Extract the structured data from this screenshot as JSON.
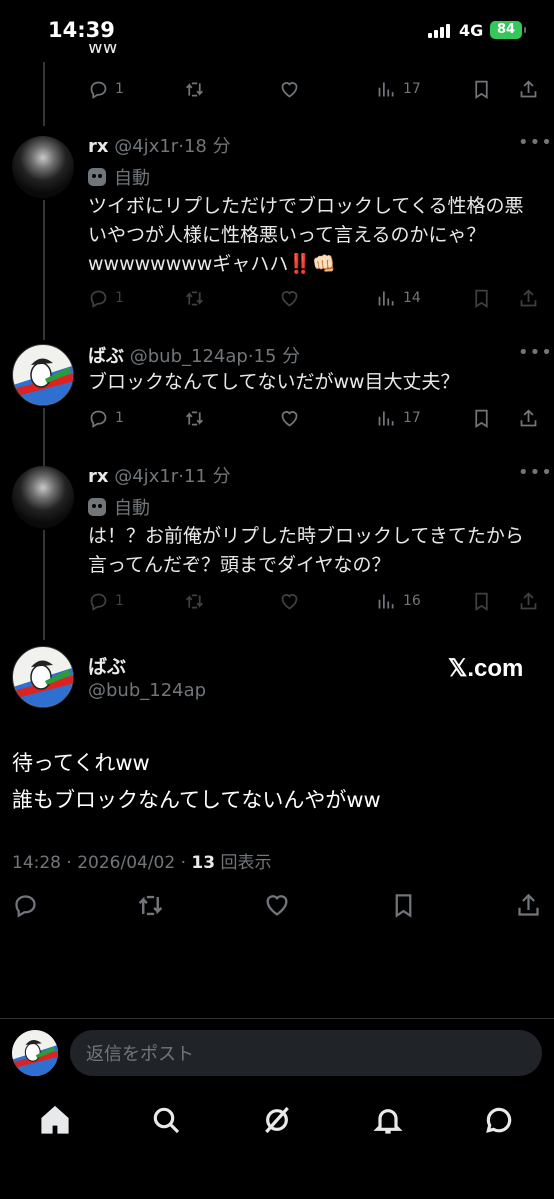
{
  "status_bar": {
    "time": "14:39",
    "network": "4G",
    "battery": "84"
  },
  "top_partial_text": "ww",
  "thread": [
    {
      "actions": {
        "replies": "1",
        "views": "17"
      }
    },
    {
      "name": "rx",
      "handle": "@4jx1r",
      "time": "18 分",
      "automated_label": "自動",
      "text": "ツイボにリプしただけでブロックしてくる性格の悪いやつが人様に性格悪いって言えるのかにゃ？wwwwwwwwギャハハ‼️👊🏻",
      "actions": {
        "replies": "1",
        "views": "14"
      }
    },
    {
      "name": "ばぶ",
      "handle": "@bub_124ap",
      "time": "15 分",
      "text": "ブロックなんてしてないだがww目大丈夫？",
      "actions": {
        "replies": "1",
        "views": "17"
      }
    },
    {
      "name": "rx",
      "handle": "@4jx1r",
      "time": "11 分",
      "automated_label": "自動",
      "text": "は！？お前俺がリプした時ブロックしてきてたから言ってんだぞ？頭までダイヤなの？",
      "actions": {
        "replies": "1",
        "views": "16"
      }
    }
  ],
  "main_tweet": {
    "name": "ばぶ",
    "handle": "@bub_124ap",
    "watermark": "𝕏.com",
    "line1": "待ってくれww",
    "line2": "誰もブロックなんてしてないんやがww",
    "timestamp": "14:28 · 2026/04/02 · ",
    "views_count": "13",
    "views_label": " 回表示"
  },
  "reply": {
    "placeholder": "返信をポスト"
  },
  "icons": [
    "reply-icon",
    "retweet-icon",
    "like-icon",
    "views-icon",
    "bookmark-icon",
    "share-icon",
    "more-icon",
    "home-icon",
    "search-icon",
    "grok-icon",
    "notifications-icon",
    "messages-icon"
  ],
  "colors": {
    "background": "#000000",
    "secondary_text": "#71767b",
    "battery_green": "#34c759"
  }
}
